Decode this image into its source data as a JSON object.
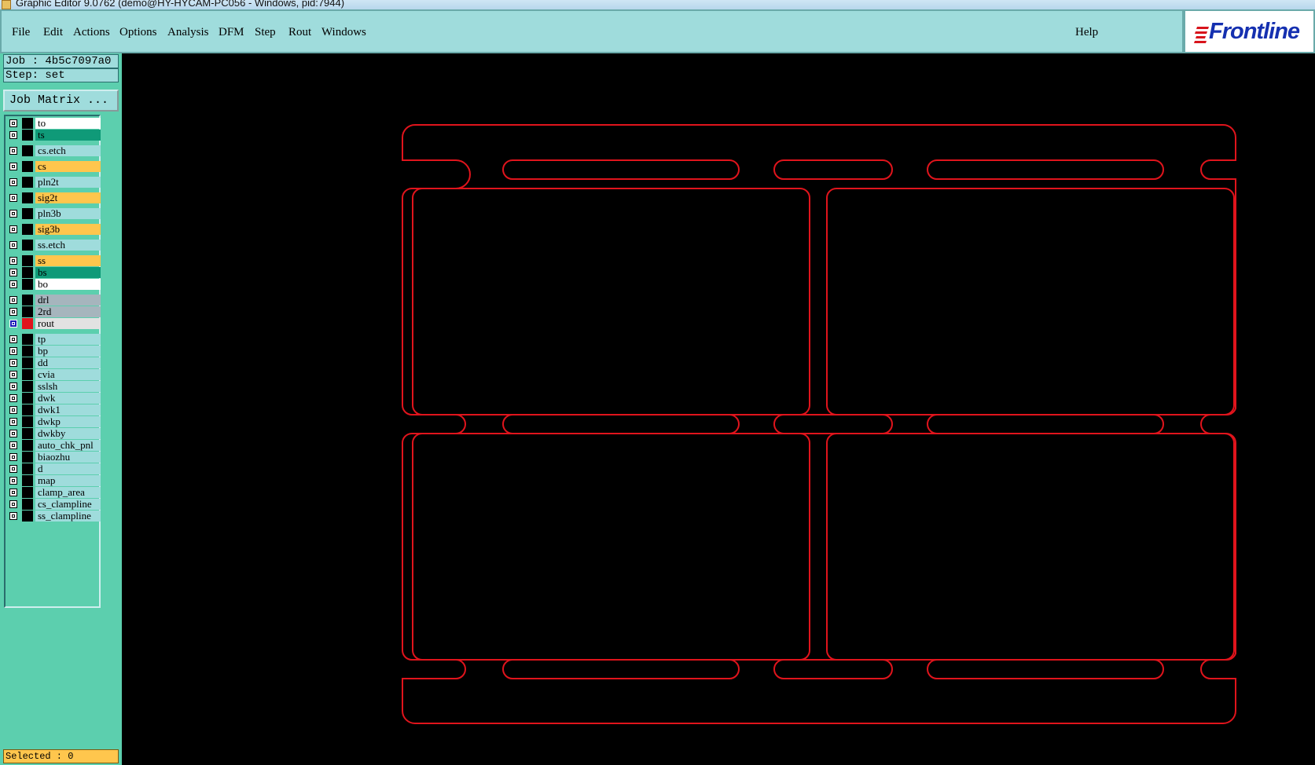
{
  "window": {
    "title": "Graphic Editor 9.0762 (demo@HY-HYCAM-PC056 - Windows, pid:7944)"
  },
  "menu": {
    "items": [
      "File",
      "Edit",
      "Actions",
      "Options",
      "Analysis",
      "DFM",
      "Step",
      "Rout",
      "Windows"
    ],
    "help": "Help"
  },
  "logo": {
    "text": "Frontline"
  },
  "panel": {
    "job_label": "Job : 4b5c7097a0",
    "step_label": "Step: set",
    "job_matrix": "Job Matrix ...",
    "selected": "Selected : 0"
  },
  "layers": [
    {
      "name": "to",
      "color": "#ffffff"
    },
    {
      "name": "ts",
      "color": "#0f9a78"
    },
    {
      "name": "cs.etch",
      "color": "#9fdcdc"
    },
    {
      "name": "cs",
      "color": "#ffc64d"
    },
    {
      "name": "pln2t",
      "color": "#9fdcdc"
    },
    {
      "name": "sig2t",
      "color": "#ffc64d"
    },
    {
      "name": "pln3b",
      "color": "#9fdcdc"
    },
    {
      "name": "sig3b",
      "color": "#ffc64d"
    },
    {
      "name": "ss.etch",
      "color": "#9fdcdc"
    },
    {
      "name": "ss",
      "color": "#ffc64d"
    },
    {
      "name": "bs",
      "color": "#0f9a78"
    },
    {
      "name": "bo",
      "color": "#ffffff"
    },
    {
      "name": "drl",
      "color": "#a6b5bd"
    },
    {
      "name": "2rd",
      "color": "#a6b5bd"
    },
    {
      "name": "rout",
      "color": "#e2e2e2",
      "active": true
    },
    {
      "name": "tp",
      "color": "#9fdcdc"
    },
    {
      "name": "bp",
      "color": "#9fdcdc"
    },
    {
      "name": "dd",
      "color": "#9fdcdc"
    },
    {
      "name": "cvia",
      "color": "#9fdcdc"
    },
    {
      "name": "sslsh",
      "color": "#9fdcdc"
    },
    {
      "name": "dwk",
      "color": "#9fdcdc"
    },
    {
      "name": "dwk1",
      "color": "#9fdcdc"
    },
    {
      "name": "dwkp",
      "color": "#9fdcdc"
    },
    {
      "name": "dwkby",
      "color": "#9fdcdc"
    },
    {
      "name": "auto_chk_pnl",
      "color": "#9fdcdc"
    },
    {
      "name": "biaozhu",
      "color": "#9fdcdc"
    },
    {
      "name": "d",
      "color": "#9fdcdc"
    },
    {
      "name": "map",
      "color": "#9fdcdc"
    },
    {
      "name": "clamp_area",
      "color": "#9fdcdc"
    },
    {
      "name": "cs_clampline",
      "color": "#9fdcdc"
    },
    {
      "name": "ss_clampline",
      "color": "#9fdcdc"
    }
  ],
  "colors": {
    "rout_stroke": "#e0141c",
    "active_swatch": "#e0141c"
  }
}
